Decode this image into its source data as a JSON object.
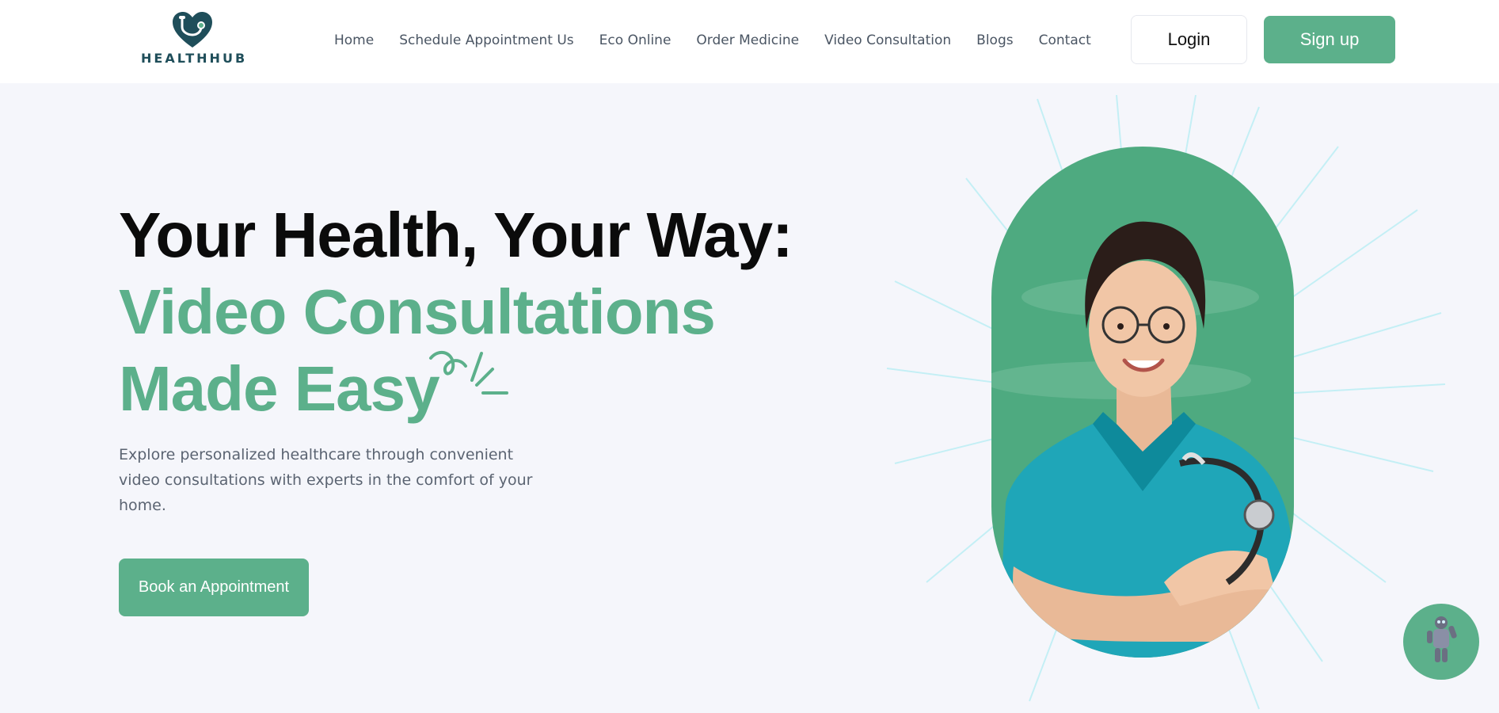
{
  "brand": {
    "name": "HEALTHHUB",
    "logo_icon": "heart-stethoscope-icon",
    "color": "#1f4e5a"
  },
  "nav": {
    "items": [
      {
        "label": "Home"
      },
      {
        "label": "Schedule Appointment Us"
      },
      {
        "label": "Eco Online"
      },
      {
        "label": "Order Medicine"
      },
      {
        "label": "Video Consultation"
      },
      {
        "label": "Blogs"
      },
      {
        "label": "Contact"
      }
    ]
  },
  "auth": {
    "login_label": "Login",
    "signup_label": "Sign up"
  },
  "hero": {
    "title_line1": "Your Health, Your Way:",
    "title_line2": "Video Consultations",
    "title_line3": "Made Easy",
    "description": "Explore personalized healthcare through convenient video consultations with experts in the comfort of your home.",
    "cta_label": "Book an Appointment",
    "image": "doctor-portrait"
  },
  "chat": {
    "icon": "robot-assistant-icon"
  },
  "colors": {
    "accent": "#5cb08b",
    "background": "#f5f6fb",
    "heading": "#0b0b0b",
    "body_text": "#5b6472"
  }
}
